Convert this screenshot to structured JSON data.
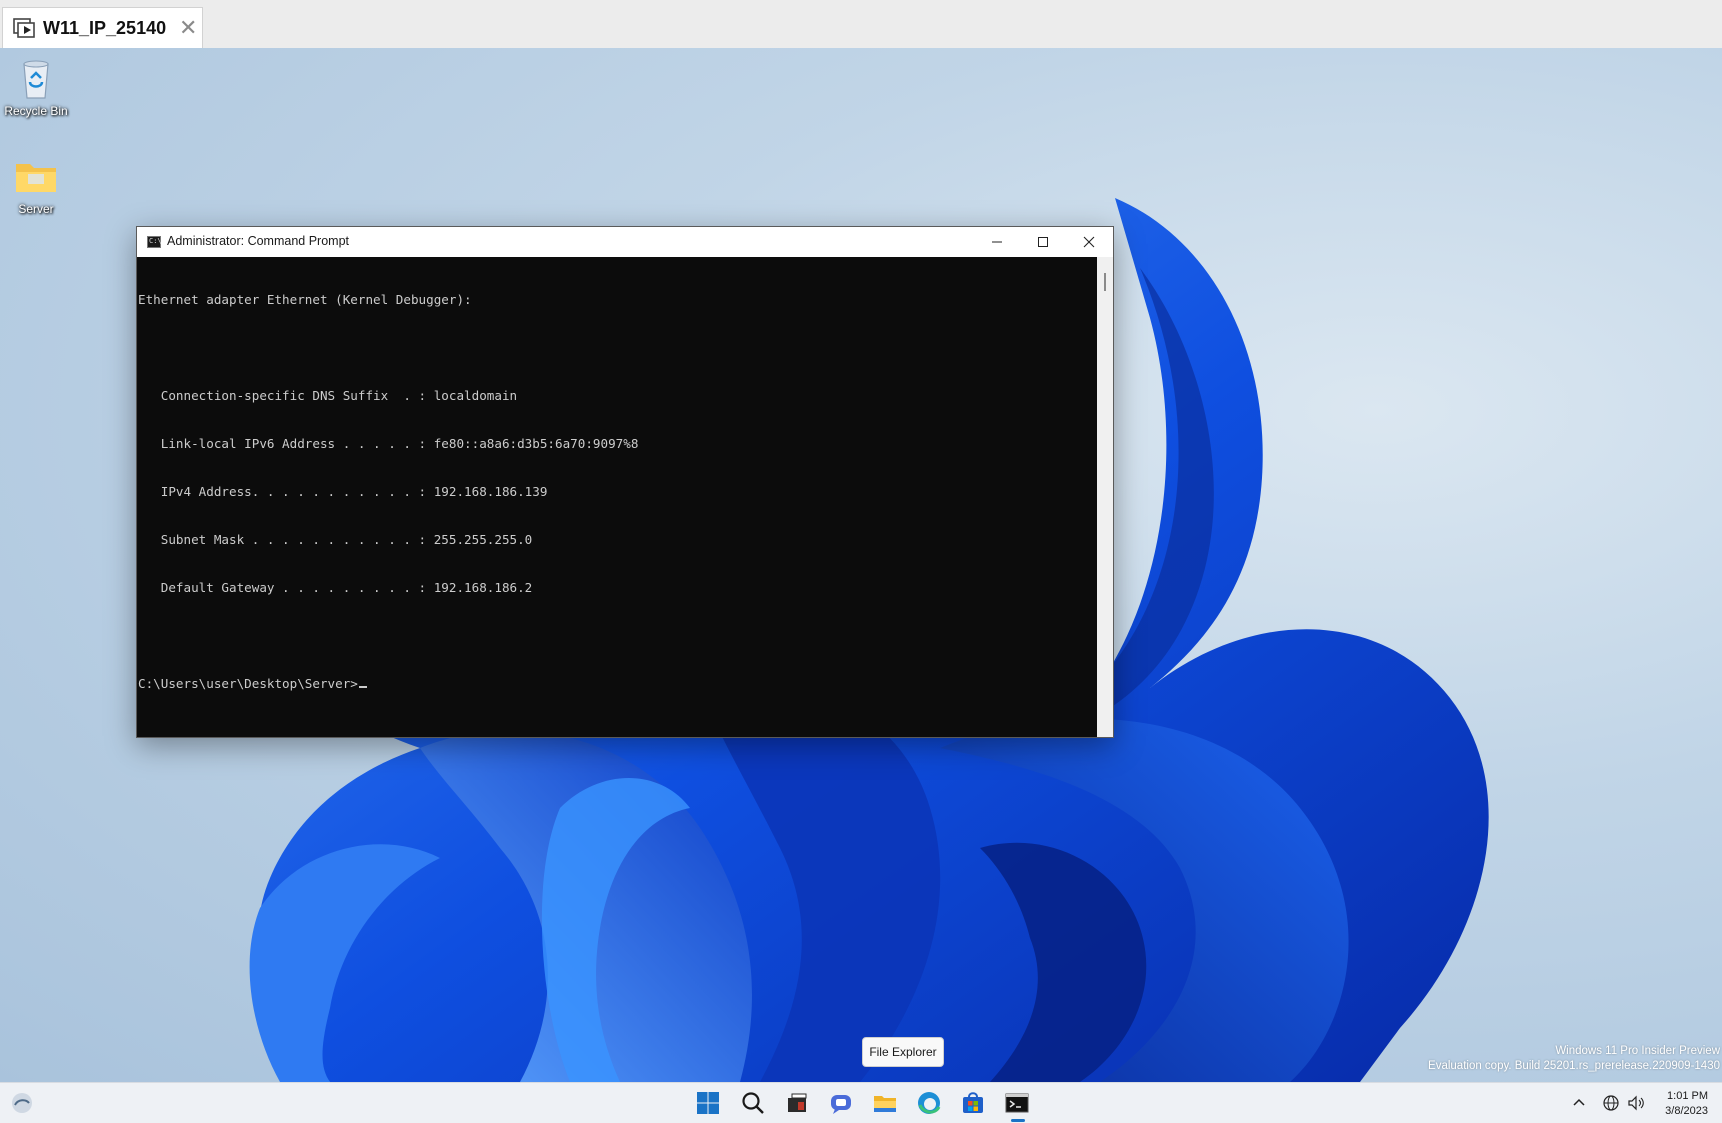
{
  "vm_tab": {
    "title": "W11_IP_25140"
  },
  "desktop_icons": [
    {
      "label": "Recycle Bin",
      "icon": "recycle-bin-icon"
    },
    {
      "label": "Server",
      "icon": "folder-icon"
    }
  ],
  "cmd_window": {
    "title": "Administrator: Command Prompt",
    "lines": [
      "Ethernet adapter Ethernet (Kernel Debugger):",
      "",
      "   Connection-specific DNS Suffix  . : localdomain",
      "   Link-local IPv6 Address . . . . . : fe80::a8a6:d3b5:6a70:9097%8",
      "   IPv4 Address. . . . . . . . . . . : 192.168.186.139",
      "   Subnet Mask . . . . . . . . . . . : 255.255.255.0",
      "   Default Gateway . . . . . . . . . : 192.168.186.2",
      ""
    ],
    "prompt": "C:\\Users\\user\\Desktop\\Server>"
  },
  "watermark": {
    "line1": "Windows 11 Pro Insider Preview",
    "line2": "Evaluation copy. Build 25201.rs_prerelease.220909-1430"
  },
  "tooltip": {
    "text": "File Explorer"
  },
  "taskbar": {
    "items": [
      "widgets-icon",
      "start-icon",
      "search-icon",
      "task-view-icon",
      "chat-icon",
      "file-explorer-icon",
      "edge-icon",
      "store-icon",
      "terminal-icon"
    ],
    "accent": "#1a73c6"
  },
  "tray": {
    "time": "1:01 PM",
    "date": "3/8/2023",
    "icons": [
      "chevron-up-icon",
      "network-icon",
      "volume-icon"
    ]
  }
}
